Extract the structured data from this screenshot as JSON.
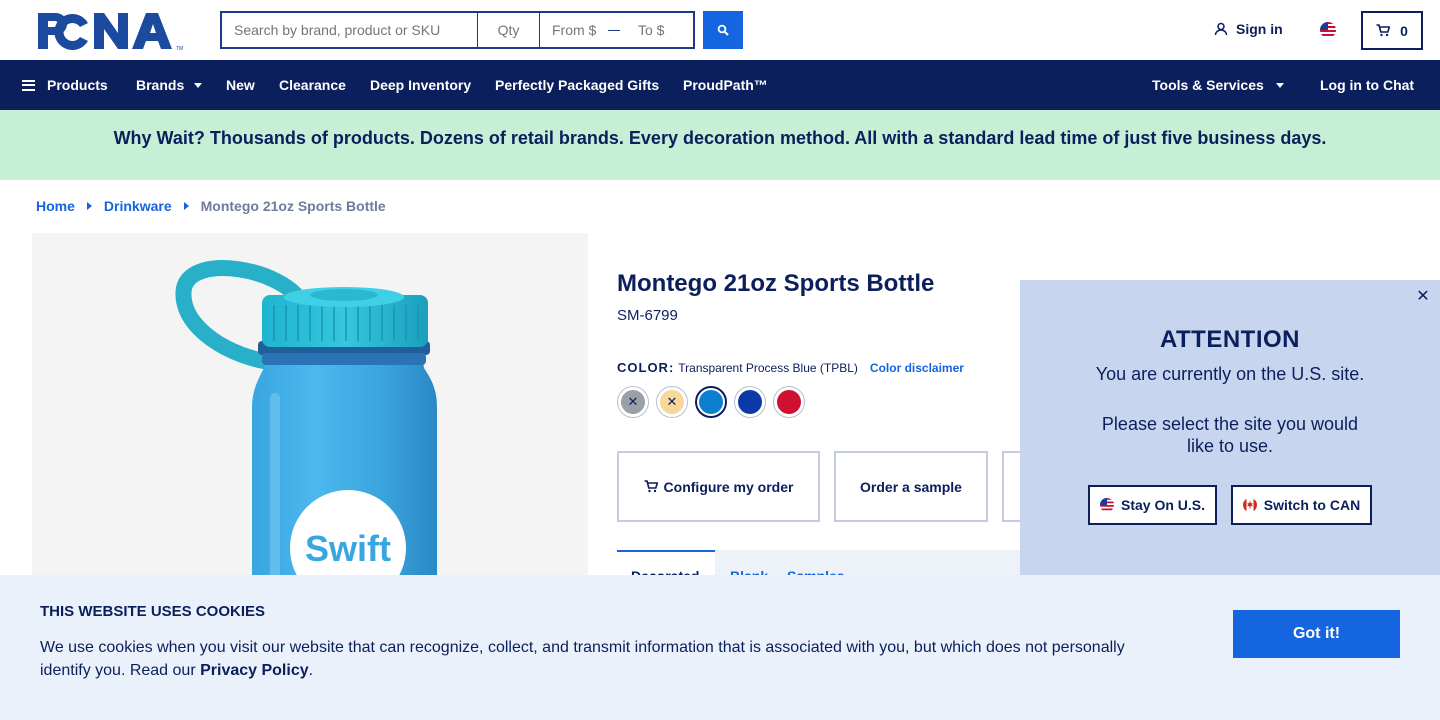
{
  "header": {
    "logo_text": "PCNA",
    "search_placeholder": "Search by brand, product or SKU",
    "qty_placeholder": "Qty",
    "price_from_placeholder": "From $",
    "price_to_placeholder": "To $",
    "signin_label": "Sign in",
    "cart_count": "0"
  },
  "nav": {
    "products": "Products",
    "brands": "Brands",
    "new": "New",
    "clearance": "Clearance",
    "deep_inventory": "Deep Inventory",
    "gifts": "Perfectly Packaged Gifts",
    "proudpath": "ProudPath™",
    "tools": "Tools & Services",
    "chat": "Log in to Chat"
  },
  "promo": {
    "text": "Why Wait? Thousands of products. Dozens of retail brands. Every decoration method. All with a standard lead time of just five business days."
  },
  "breadcrumb": {
    "home": "Home",
    "category": "Drinkware",
    "current": "Montego 21oz Sports Bottle"
  },
  "product": {
    "title": "Montego 21oz Sports Bottle",
    "sku": "SM-6799",
    "color_label": "COLOR:",
    "color_name": "Transparent Process Blue (TPBL)",
    "color_disclaimer": "Color disclaimer",
    "image_logo_text": "Swift",
    "swatches": [
      {
        "color": "#9aa0a8",
        "unavailable": true
      },
      {
        "color": "#f7d79a",
        "unavailable": true
      },
      {
        "color": "#0a7fd0",
        "unavailable": false
      },
      {
        "color": "#0b3aa8",
        "unavailable": false
      },
      {
        "color": "#cf1030",
        "unavailable": false
      }
    ],
    "configure_label": "Configure my order",
    "sample_label": "Order a sample",
    "tab1_label": "Decorated",
    "tab2_label": "Blank",
    "tab3_label": "Samples"
  },
  "attention": {
    "title": "ATTENTION",
    "line1": "You are currently on the U.S. site.",
    "line2": "Please select the site you would like to use.",
    "stay_label": "Stay On U.S.",
    "switch_label": "Switch to CAN"
  },
  "cookie": {
    "title": "THIS WEBSITE USES COOKIES",
    "text_before": "We use cookies when you visit our website that can recognize, collect, and transmit information that is associated with you, but which does not personally identify you. Read our ",
    "link": "Privacy Policy",
    "text_after": ".",
    "button": "Got it!"
  },
  "colors": {
    "navy": "#0b1f5c",
    "accent_blue": "#1565e0",
    "promo_green": "#c6efd6",
    "modal_blue": "#c7d6ee",
    "cookie_bg": "#ebf1fb"
  }
}
